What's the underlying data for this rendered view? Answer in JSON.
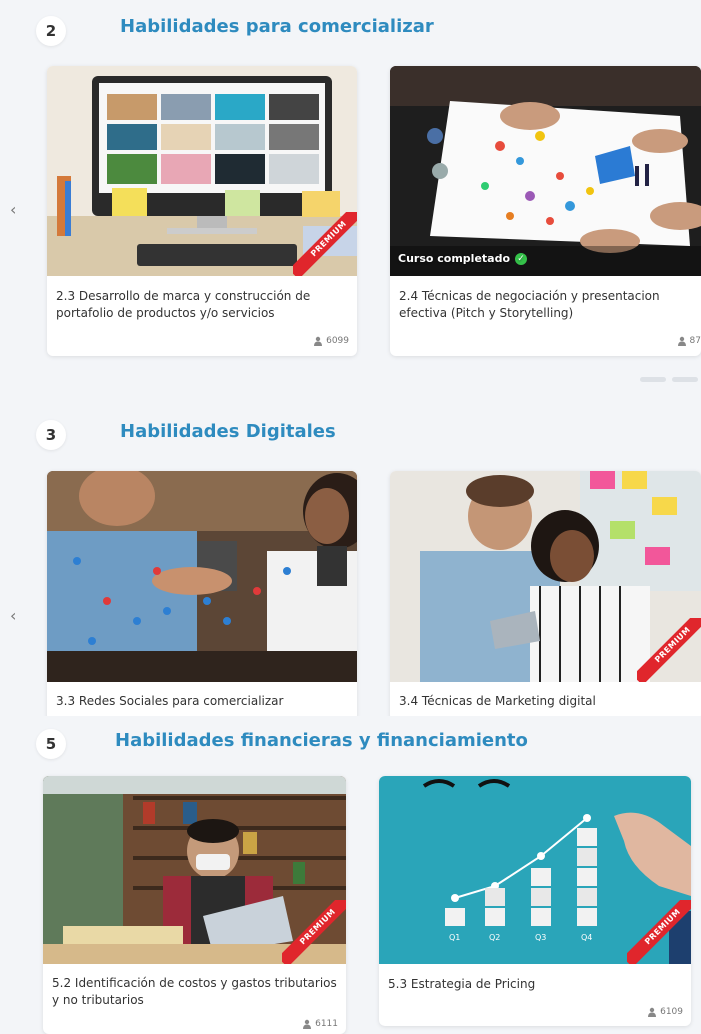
{
  "sections": [
    {
      "number": "2",
      "title": "Habilidades para comercializar",
      "cards": [
        {
          "title": "2.3 Desarrollo de marca y construcción de portafolio de productos y/o servicios",
          "enrolled": "6099",
          "premium": "PREMIUM"
        },
        {
          "title": "2.4 Técnicas de negociación y presentacion efectiva (Pitch y Storytelling)",
          "enrolled": "87",
          "completed": "Curso completado"
        }
      ]
    },
    {
      "number": "3",
      "title": "Habilidades Digitales",
      "cards": [
        {
          "title": "3.3 Redes Sociales para comercializar"
        },
        {
          "title": "3.4 Técnicas de Marketing digital",
          "premium": "PREMIUM"
        }
      ]
    },
    {
      "number": "5",
      "title": "Habilidades financieras y financiamiento",
      "cards": [
        {
          "title": "5.2 Identificación de costos y gastos tributarios y no tributarios",
          "enrolled": "6111",
          "premium": "PREMIUM"
        },
        {
          "title": "5.3 Estrategia de Pricing",
          "enrolled": "6109",
          "premium": "PREMIUM"
        }
      ]
    }
  ],
  "nav": {
    "prev_arrow": "‹"
  },
  "chart_labels": [
    "Q1",
    "Q2",
    "Q3",
    "Q4"
  ],
  "icons": {
    "enrolled": "user-icon",
    "completed": "check-circle-icon"
  },
  "colors": {
    "section_title": "#2e8bbf",
    "premium_ribbon": "#e0262c",
    "check": "#35c24a"
  }
}
